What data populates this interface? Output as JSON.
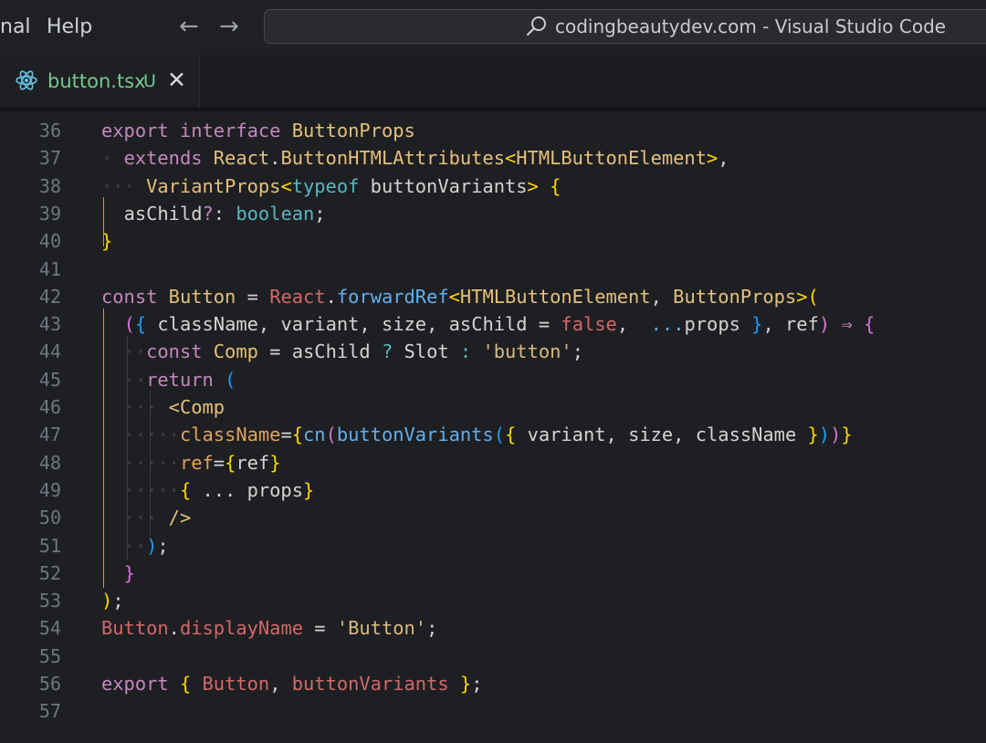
{
  "menu": {
    "items": [
      "nal",
      "Help"
    ]
  },
  "search": {
    "text": "codingbeautydev.com - Visual Studio Code"
  },
  "tab": {
    "filename": "button.tsx",
    "badge": "U"
  },
  "editor": {
    "lines": [
      {
        "num": "36",
        "segments": [
          [
            "kw",
            "export"
          ],
          [
            "ws",
            " "
          ],
          [
            "kw",
            "interface"
          ],
          [
            "ws",
            " "
          ],
          [
            "type",
            "ButtonProps"
          ]
        ]
      },
      {
        "num": "37",
        "segments": [
          [
            "ws",
            "· "
          ],
          [
            "kw",
            "extends"
          ],
          [
            "ws",
            " "
          ],
          [
            "type",
            "React"
          ],
          [
            "plain",
            "."
          ],
          [
            "type",
            "ButtonHTMLAttributes"
          ],
          [
            "b1",
            "<"
          ],
          [
            "type",
            "HTMLButtonElement"
          ],
          [
            "b1",
            ">"
          ],
          [
            "plain",
            ","
          ]
        ]
      },
      {
        "num": "38",
        "segments": [
          [
            "ws",
            "··· "
          ],
          [
            "type",
            "VariantProps"
          ],
          [
            "b1",
            "<"
          ],
          [
            "bool",
            "typeof"
          ],
          [
            "ws",
            " "
          ],
          [
            "id",
            "buttonVariants"
          ],
          [
            "b1",
            ">"
          ],
          [
            "ws",
            " "
          ],
          [
            "b1",
            "{"
          ]
        ]
      },
      {
        "num": "39",
        "segments": [
          [
            "ws",
            "  "
          ],
          [
            "id",
            "asChild"
          ],
          [
            "kw",
            "?"
          ],
          [
            "plain",
            ":"
          ],
          [
            "ws",
            " "
          ],
          [
            "bool",
            "boolean"
          ],
          [
            "plain",
            ";"
          ]
        ]
      },
      {
        "num": "40",
        "segments": [
          [
            "b1",
            "}"
          ]
        ]
      },
      {
        "num": "41",
        "segments": []
      },
      {
        "num": "42",
        "segments": [
          [
            "kw",
            "const"
          ],
          [
            "ws",
            " "
          ],
          [
            "type",
            "Button"
          ],
          [
            "ws",
            " "
          ],
          [
            "op",
            "="
          ],
          [
            "ws",
            " "
          ],
          [
            "kw2",
            "React"
          ],
          [
            "plain",
            "."
          ],
          [
            "fn",
            "forwardRef"
          ],
          [
            "b1",
            "<"
          ],
          [
            "type",
            "HTMLButtonElement"
          ],
          [
            "plain",
            ","
          ],
          [
            "ws",
            " "
          ],
          [
            "type",
            "ButtonProps"
          ],
          [
            "b1",
            ">("
          ]
        ]
      },
      {
        "num": "43",
        "segments": [
          [
            "ws",
            "  "
          ],
          [
            "b2",
            "("
          ],
          [
            "b3",
            "{"
          ],
          [
            "ws",
            " "
          ],
          [
            "id",
            "className"
          ],
          [
            "plain",
            ","
          ],
          [
            "ws",
            " "
          ],
          [
            "id",
            "variant"
          ],
          [
            "plain",
            ","
          ],
          [
            "ws",
            " "
          ],
          [
            "id",
            "size"
          ],
          [
            "plain",
            ","
          ],
          [
            "ws",
            " "
          ],
          [
            "id",
            "asChild"
          ],
          [
            "ws",
            " "
          ],
          [
            "op",
            "="
          ],
          [
            "ws",
            " "
          ],
          [
            "kw2",
            "false"
          ],
          [
            "plain",
            ","
          ],
          [
            "ws",
            "  "
          ],
          [
            "fn",
            "..."
          ],
          [
            "id",
            "props"
          ],
          [
            "ws",
            " "
          ],
          [
            "b3",
            "}"
          ],
          [
            "plain",
            ","
          ],
          [
            "ws",
            " "
          ],
          [
            "id",
            "ref"
          ],
          [
            "b2",
            ")"
          ],
          [
            "ws",
            " "
          ],
          [
            "kw",
            "⇒"
          ],
          [
            "ws",
            " "
          ],
          [
            "b2",
            "{"
          ]
        ]
      },
      {
        "num": "44",
        "segments": [
          [
            "ws",
            "  ··"
          ],
          [
            "kw",
            "const"
          ],
          [
            "ws",
            " "
          ],
          [
            "type",
            "Comp"
          ],
          [
            "ws",
            " "
          ],
          [
            "op",
            "="
          ],
          [
            "ws",
            " "
          ],
          [
            "id",
            "asChild"
          ],
          [
            "ws",
            " "
          ],
          [
            "bool",
            "?"
          ],
          [
            "ws",
            " "
          ],
          [
            "id",
            "Slot"
          ],
          [
            "ws",
            " "
          ],
          [
            "bool",
            ":"
          ],
          [
            "ws",
            " "
          ],
          [
            "str",
            "'button'"
          ],
          [
            "plain",
            ";"
          ]
        ]
      },
      {
        "num": "45",
        "segments": [
          [
            "ws",
            "  ··"
          ],
          [
            "kw",
            "return"
          ],
          [
            "ws",
            " "
          ],
          [
            "b3",
            "("
          ]
        ]
      },
      {
        "num": "46",
        "segments": [
          [
            "ws",
            "  ··· "
          ],
          [
            "tag",
            "<Comp"
          ]
        ]
      },
      {
        "num": "47",
        "segments": [
          [
            "ws",
            "  ·····"
          ],
          [
            "attr",
            "className"
          ],
          [
            "op",
            "="
          ],
          [
            "b1",
            "{"
          ],
          [
            "fn",
            "cn"
          ],
          [
            "b2",
            "("
          ],
          [
            "fn",
            "buttonVariants"
          ],
          [
            "b3",
            "("
          ],
          [
            "b1",
            "{"
          ],
          [
            "ws",
            " "
          ],
          [
            "id",
            "variant"
          ],
          [
            "plain",
            ","
          ],
          [
            "ws",
            " "
          ],
          [
            "id",
            "size"
          ],
          [
            "plain",
            ","
          ],
          [
            "ws",
            " "
          ],
          [
            "id",
            "className"
          ],
          [
            "ws",
            " "
          ],
          [
            "b1",
            "}"
          ],
          [
            "b3",
            ")"
          ],
          [
            "b2",
            ")"
          ],
          [
            "b1",
            "}"
          ]
        ]
      },
      {
        "num": "48",
        "segments": [
          [
            "ws",
            "  ·····"
          ],
          [
            "attr",
            "ref"
          ],
          [
            "op",
            "="
          ],
          [
            "b1",
            "{"
          ],
          [
            "id",
            "ref"
          ],
          [
            "b1",
            "}"
          ]
        ]
      },
      {
        "num": "49",
        "segments": [
          [
            "ws",
            "  ·····"
          ],
          [
            "b1",
            "{"
          ],
          [
            "ws",
            " "
          ],
          [
            "id",
            "... props"
          ],
          [
            "b1",
            "}"
          ]
        ]
      },
      {
        "num": "50",
        "segments": [
          [
            "ws",
            "  ··· "
          ],
          [
            "tag",
            "/>"
          ]
        ]
      },
      {
        "num": "51",
        "segments": [
          [
            "ws",
            "  ··"
          ],
          [
            "b3",
            ")"
          ],
          [
            "plain",
            ";"
          ]
        ]
      },
      {
        "num": "52",
        "segments": [
          [
            "ws",
            "  "
          ],
          [
            "b2",
            "}"
          ]
        ]
      },
      {
        "num": "53",
        "segments": [
          [
            "b1",
            ")"
          ],
          [
            "plain",
            ";"
          ]
        ]
      },
      {
        "num": "54",
        "segments": [
          [
            "kw2",
            "Button"
          ],
          [
            "plain",
            "."
          ],
          [
            "kw2",
            "displayName"
          ],
          [
            "ws",
            " "
          ],
          [
            "op",
            "="
          ],
          [
            "ws",
            " "
          ],
          [
            "str",
            "'Button'"
          ],
          [
            "plain",
            ";"
          ]
        ]
      },
      {
        "num": "55",
        "segments": []
      },
      {
        "num": "56",
        "segments": [
          [
            "kw",
            "export"
          ],
          [
            "ws",
            " "
          ],
          [
            "b1",
            "{"
          ],
          [
            "ws",
            " "
          ],
          [
            "kw2",
            "Button"
          ],
          [
            "plain",
            ","
          ],
          [
            "ws",
            " "
          ],
          [
            "kw2",
            "buttonVariants"
          ],
          [
            "ws",
            " "
          ],
          [
            "b1",
            "}"
          ],
          [
            "plain",
            ";"
          ]
        ]
      },
      {
        "num": "57",
        "segments": []
      }
    ]
  }
}
